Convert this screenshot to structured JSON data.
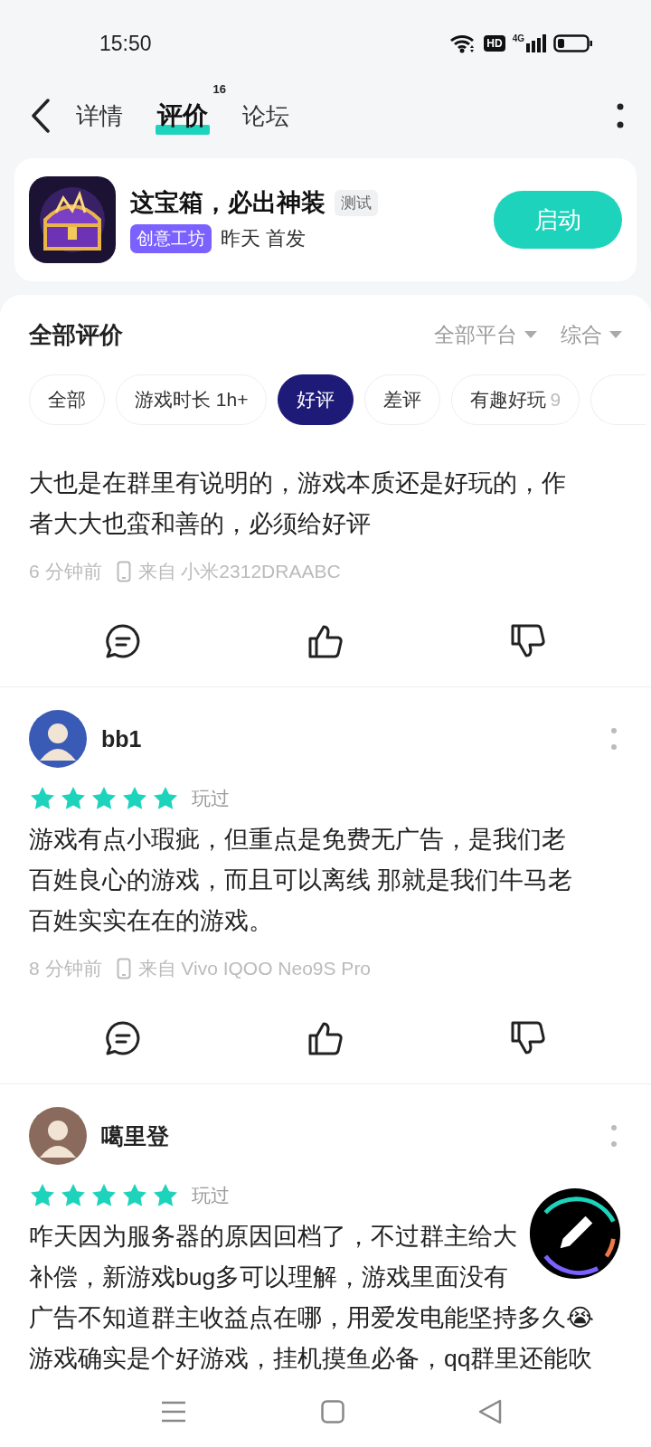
{
  "status_bar": {
    "time": "15:50",
    "hd": "HD",
    "network": "4G"
  },
  "header": {
    "tabs": [
      {
        "label": "详情",
        "selected": false
      },
      {
        "label": "评价",
        "selected": true,
        "badge": "16"
      },
      {
        "label": "论坛",
        "selected": false
      }
    ]
  },
  "app_card": {
    "name": "这宝箱，必出神装",
    "tag": "测试",
    "category": "创意工坊",
    "release": "昨天 首发",
    "button": "启动"
  },
  "reviews_section": {
    "title": "全部评价",
    "dropdowns": [
      "全部平台",
      "综合"
    ],
    "chips": [
      {
        "label": "全部",
        "selected": false
      },
      {
        "label": "游戏时长 1h+",
        "selected": false
      },
      {
        "label": "好评",
        "selected": true
      },
      {
        "label": "差评",
        "selected": false
      },
      {
        "label": "有趣好玩",
        "count": "9",
        "selected": false
      }
    ],
    "reviews": [
      {
        "text": "大也是在群里有说明的，游戏本质还是好玩的，作者大大也蛮和善的，必须给好评",
        "time": "6 分钟前",
        "device": "来自 小米2312DRAABC"
      },
      {
        "user": "bb1",
        "stars": 5,
        "status": "玩过",
        "text": "游戏有点小瑕疵，但重点是免费无广告，是我们老百姓良心的游戏，而且可以离线 那就是我们牛马老百姓实实在在的游戏。",
        "time": "8 分钟前",
        "device": "来自 Vivo IQOO Neo9S Pro"
      },
      {
        "user": "噶里登",
        "stars": 5,
        "status": "玩过",
        "text_lines": [
          "咋天因为服务器的原因回档了，不过群主给大",
          "补偿，新游戏bug多可以理解，游戏里面没有",
          "广告不知道群主收益点在哪，用爱发电能坚持多久😭",
          "游戏确实是个好游戏，挂机摸鱼必备，qq群里还能吹"
        ]
      }
    ]
  }
}
